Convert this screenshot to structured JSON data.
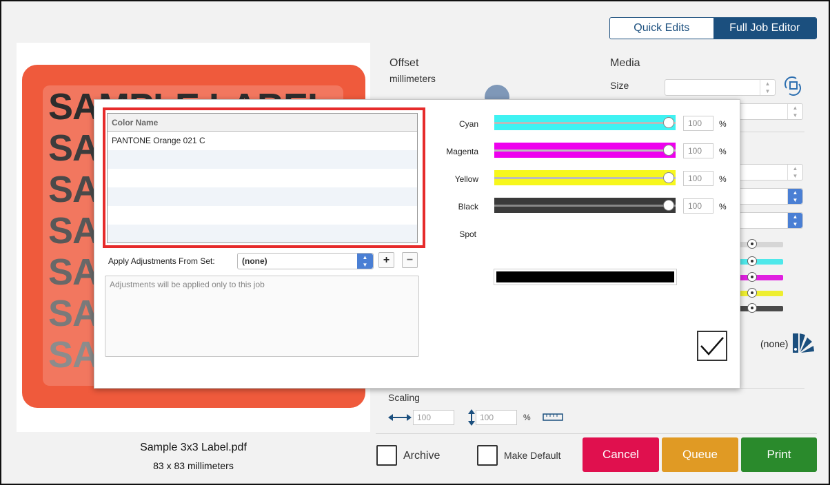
{
  "mode_toggle": {
    "quick_edits": "Quick Edits",
    "full_job_editor": "Full Job Editor"
  },
  "preview": {
    "label_text": "SAMPLE LABEL",
    "file_name": "Sample 3x3 Label.pdf",
    "file_size": "83 x 83 millimeters"
  },
  "offset": {
    "title": "Offset",
    "units": "millimeters"
  },
  "media": {
    "title": "Media",
    "size_label": "Size"
  },
  "color_set": {
    "value": "(none)"
  },
  "scaling": {
    "title": "Scaling",
    "width": "100",
    "height": "100",
    "unit": "%"
  },
  "archive_label": "Archive",
  "make_default_label": "Make Default",
  "buttons": {
    "cancel": "Cancel",
    "queue": "Queue",
    "print": "Print"
  },
  "dialog": {
    "table": {
      "header": "Color Name",
      "rows": [
        "PANTONE Orange 021 C",
        "",
        "",
        "",
        "",
        ""
      ]
    },
    "apply_label": "Apply Adjustments From Set:",
    "apply_value": "(none)",
    "note": "Adjustments will be applied only to this job",
    "inks": [
      {
        "label": "Cyan",
        "value": "100",
        "color": "#3ff2f2"
      },
      {
        "label": "Magenta",
        "value": "100",
        "color": "#ee00ee"
      },
      {
        "label": "Yellow",
        "value": "100",
        "color": "#f7f71c"
      },
      {
        "label": "Black",
        "value": "100",
        "color": "#3a3a3a"
      }
    ],
    "percent": "%",
    "spot_label": "Spot"
  },
  "colors": {
    "accent": "#1b4f7e",
    "cancel": "#e0104e",
    "queue": "#e09a24",
    "print": "#2a8a2c"
  }
}
